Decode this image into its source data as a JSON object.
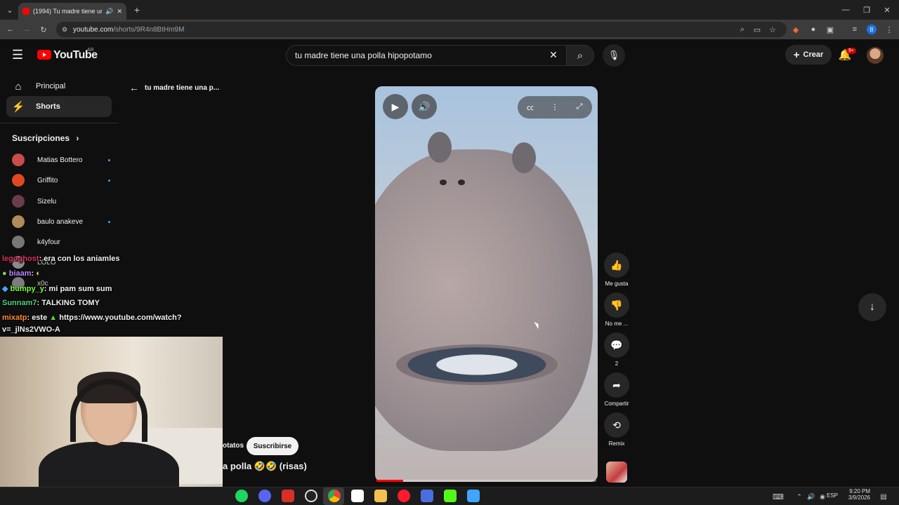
{
  "browser": {
    "tab_title": "(1994) Tu madre tiene una p",
    "url_host": "youtube.com",
    "url_path": "/shorts/9R4n8BtHm9M",
    "new_tab": "+",
    "win_min": "—",
    "win_restore": "❐",
    "win_close": "✕"
  },
  "header": {
    "logo": "YouTube",
    "country": "AR",
    "search_value": "tu madre tiene una polla hipopotamo",
    "create_label": "Crear",
    "notif_count": "9+"
  },
  "sidebar": {
    "items": [
      {
        "label": "Principal",
        "icon": "home-icon"
      },
      {
        "label": "Shorts",
        "icon": "shorts-icon"
      }
    ],
    "subs_heading": "Suscripciones",
    "subscriptions": [
      {
        "name": "Matias Bottero",
        "color": "#c94b4b",
        "new": true
      },
      {
        "name": "Griffito",
        "color": "#e0481f",
        "new": true
      },
      {
        "name": "Sizelu",
        "color": "#6b3c4a",
        "new": false
      },
      {
        "name": "baulo anakeve",
        "color": "#b38a5a",
        "new": true
      },
      {
        "name": "k4yfour",
        "color": "#777777",
        "new": false
      },
      {
        "name": "LOLO",
        "color": "#aaaaaa",
        "new": false
      },
      {
        "name": "x0c",
        "color": "#999999",
        "new": false
      }
    ]
  },
  "shorts": {
    "back_title": "tu madre tiene una p...",
    "caption": "a polla 🤣🤣 (risas)",
    "channel_partial": "otatos",
    "subscribe_label": "Suscribirse",
    "progress_fraction": 0.12,
    "actions": [
      {
        "label": "Me gusta",
        "icon": "like-icon"
      },
      {
        "label": "No me ...",
        "icon": "dislike-icon"
      },
      {
        "label": "2",
        "icon": "comment-icon"
      },
      {
        "label": "Compartir",
        "icon": "share-icon"
      },
      {
        "label": "Remix",
        "icon": "remix-icon"
      }
    ]
  },
  "chat": [
    {
      "user": "legoghost",
      "user_color": "#e0325a",
      "text": ": era con los aniamles"
    },
    {
      "user": "biaam",
      "user_color": "#b986ff",
      "text": ":"
    },
    {
      "user": "bumpy_y",
      "user_color": "#7cff3e",
      "text": ": mi pam sum sum"
    },
    {
      "user": "Sunnam7",
      "user_color": "#4fd17a",
      "text": ": TALKING TOMY"
    },
    {
      "user": "mixatp",
      "user_color": "#ff8c2e",
      "text": ": este"
    },
    {
      "user": "",
      "user_color": "#ffffff",
      "text": "https://www.youtube.com/watch?"
    },
    {
      "user": "",
      "user_color": "#ffffff",
      "text": "v=_jlNs2VWO-A"
    }
  ],
  "taskbar": {
    "time": "9:20 PM",
    "date": "3/9/2026",
    "lang": "ESP"
  }
}
